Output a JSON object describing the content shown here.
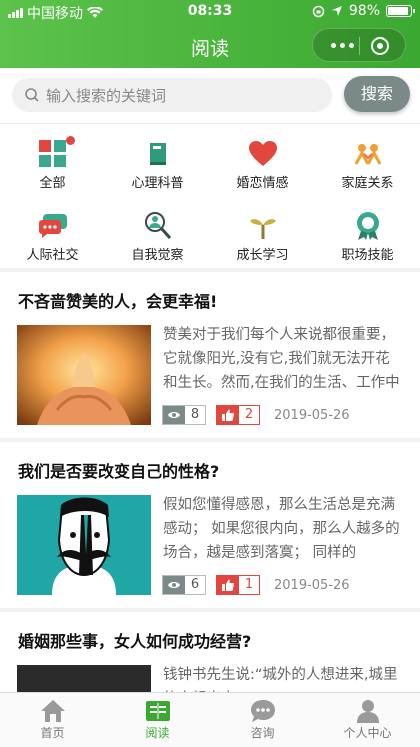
{
  "status_bar": {
    "carrier": "中国移动",
    "time": "08:33",
    "battery": "98%"
  },
  "nav": {
    "title": "阅读"
  },
  "search": {
    "placeholder": "输入搜索的关键词",
    "button_label": "搜索"
  },
  "categories": [
    {
      "label": "全部",
      "icon": "grid-icon",
      "has_dot": true
    },
    {
      "label": "心理科普",
      "icon": "book-icon"
    },
    {
      "label": "婚恋情感",
      "icon": "heart-icon"
    },
    {
      "label": "家庭关系",
      "icon": "family-icon"
    },
    {
      "label": "人际社交",
      "icon": "chat-bubble-icon"
    },
    {
      "label": "自我觉察",
      "icon": "magnifier-person-icon"
    },
    {
      "label": "成长学习",
      "icon": "sprout-icon"
    },
    {
      "label": "职场技能",
      "icon": "medal-icon"
    }
  ],
  "articles": [
    {
      "title": "不吝啬赞美的人，会更幸福!",
      "excerpt": "赞美对于我们每个人来说都很重要，它就像阳光,没有它,我们就无法开花和生长。然而,在我们的生活、工作中",
      "views": "8",
      "likes": "2",
      "date": "2019-05-26"
    },
    {
      "title": "我们是否要改变自己的性格?",
      "excerpt": "假如您懂得感恩，那么生活总是充满感动；  如果您很内向，那么人越多的场合，越是感到落寞；  同样的",
      "views": "6",
      "likes": "1",
      "date": "2019-05-26"
    },
    {
      "title": "婚姻那些事，女人如何成功经营?",
      "excerpt": "钱钟书先生说:“城外的人想进来,城里的人想出去”"
    }
  ],
  "tabbar": [
    {
      "label": "首页",
      "icon": "home-icon",
      "active": false
    },
    {
      "label": "阅读",
      "icon": "reading-icon",
      "active": true
    },
    {
      "label": "咨询",
      "icon": "consult-icon",
      "active": false
    },
    {
      "label": "个人中心",
      "icon": "user-icon",
      "active": false
    }
  ],
  "colors": {
    "primary": "#3ba931",
    "accent_red": "#e2473f",
    "grey_button": "#7a8a88"
  }
}
